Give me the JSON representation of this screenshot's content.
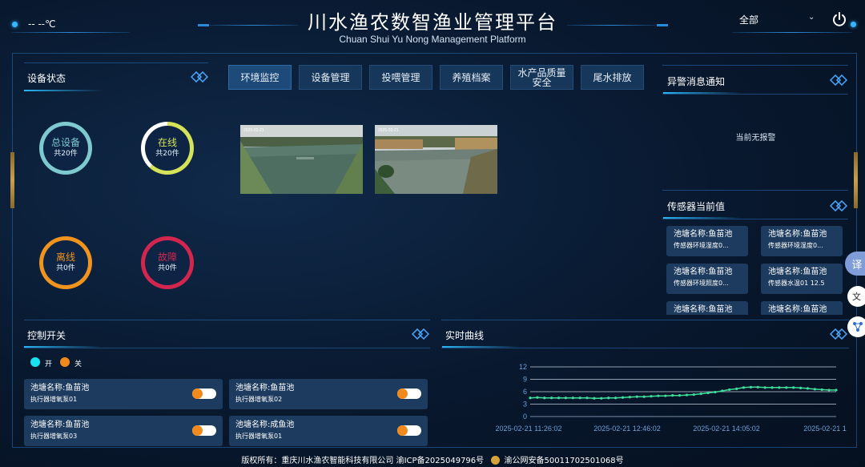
{
  "header": {
    "title": "川水渔农数智渔业管理平台",
    "subtitle": "Chuan Shui Yu Nong Management Platform",
    "temperature": "-- --℃",
    "region": "全部"
  },
  "device_status": {
    "title": "设备状态",
    "items": [
      {
        "label": "总设备",
        "count": "共20件",
        "color": "#7ec9cf",
        "fraction": 1.0
      },
      {
        "label": "在线",
        "count": "共20件",
        "color": "#d5e35a",
        "fraction": 0.62
      },
      {
        "label": "离线",
        "count": "共0件",
        "color": "#f0931f",
        "fraction": 1.0
      },
      {
        "label": "故障",
        "count": "共0件",
        "color": "#d2264e",
        "fraction": 1.0
      }
    ]
  },
  "tabs": [
    {
      "label": "环境监控",
      "active": true
    },
    {
      "label": "设备管理",
      "active": false
    },
    {
      "label": "投喂管理",
      "active": false
    },
    {
      "label": "养殖档案",
      "active": false
    },
    {
      "label": "水产品质量安全",
      "active": false
    },
    {
      "label": "尾水排放",
      "active": false
    }
  ],
  "alarm": {
    "title": "异警消息通知",
    "empty_text": "当前无报警"
  },
  "sensors": {
    "title": "传感器当前值",
    "cards": [
      {
        "pond": "池塘名称:鱼苗池",
        "value": "传感器环境湿度0..."
      },
      {
        "pond": "池塘名称:鱼苗池",
        "value": "传感器环境湿度0..."
      },
      {
        "pond": "池塘名称:鱼苗池",
        "value": "传感器环境照度0..."
      },
      {
        "pond": "池塘名称:鱼苗池",
        "value": "传感器水温01 12.5"
      },
      {
        "pond": "池塘名称:鱼苗池",
        "value": ""
      },
      {
        "pond": "池塘名称:鱼苗池",
        "value": ""
      }
    ]
  },
  "control": {
    "title": "控制开关",
    "legend_on": "开",
    "legend_off": "关",
    "on_color": "#19e3f0",
    "off_color": "#f08a1c",
    "switches": [
      {
        "pond": "池塘名称:鱼苗池",
        "device": "执行器增氧泵01",
        "state": "关"
      },
      {
        "pond": "池塘名称:鱼苗池",
        "device": "执行器增氧泵02",
        "state": "关"
      },
      {
        "pond": "池塘名称:鱼苗池",
        "device": "执行器增氧泵03",
        "state": "关"
      },
      {
        "pond": "池塘名称:成鱼池",
        "device": "执行器增氧泵01",
        "state": "关"
      }
    ]
  },
  "realtime": {
    "title": "实时曲线"
  },
  "chart_data": {
    "type": "line",
    "title": "",
    "xlabel": "",
    "ylabel": "",
    "ylim": [
      0,
      12
    ],
    "yticks": [
      0,
      3,
      6,
      9,
      12
    ],
    "xtick_labels": [
      "2025-02-21 11:26:02",
      "2025-02-21 12:46:02",
      "2025-02-21 14:05:02",
      "2025-02-21 1"
    ],
    "line_color": "#3dde9a",
    "series": [
      {
        "values": [
          4.5,
          4.6,
          4.5,
          4.5,
          4.5,
          4.5,
          4.5,
          4.5,
          4.5,
          4.4,
          4.4,
          4.5,
          4.5,
          4.6,
          4.7,
          4.8,
          4.8,
          4.9,
          5.0,
          5.0,
          5.1,
          5.1,
          5.2,
          5.3,
          5.5,
          5.7,
          5.9,
          6.2,
          6.5,
          6.7,
          7.0,
          7.1,
          7.1,
          7.0,
          7.0,
          7.0,
          7.0,
          7.0,
          6.9,
          6.8,
          6.6,
          6.5,
          6.4,
          6.4
        ]
      }
    ]
  },
  "footer": {
    "copyright": "版权所有：重庆川水渔农智能科技有限公司  渝ICP备2025049796号",
    "police": "渝公网安备50011702501068号"
  },
  "float_tab": "译"
}
